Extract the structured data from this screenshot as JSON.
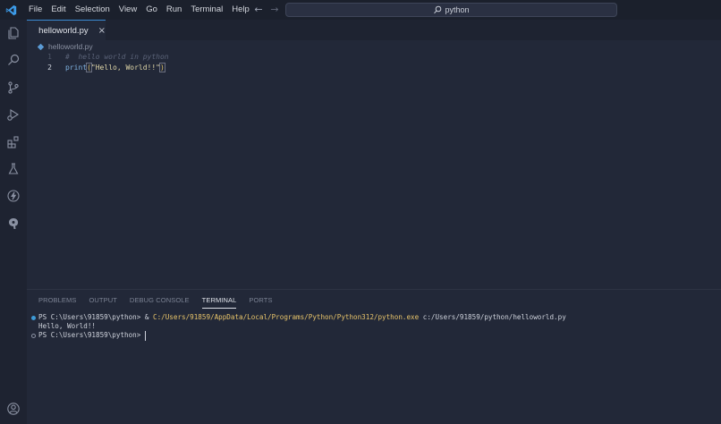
{
  "menu": {
    "items": [
      "File",
      "Edit",
      "Selection",
      "View",
      "Go",
      "Run",
      "Terminal",
      "Help"
    ]
  },
  "search": {
    "text": "python"
  },
  "tab": {
    "label": "helloworld.py",
    "close": "×"
  },
  "breadcrumb": {
    "file": "helloworld.py"
  },
  "editor": {
    "lines": [
      {
        "number": "1",
        "comment": "#  hello world in python"
      },
      {
        "number": "2",
        "fn": "print",
        "open": "(",
        "string": "\"Hello, World!!\"",
        "close": ")"
      }
    ]
  },
  "panel": {
    "tabs": [
      "PROBLEMS",
      "OUTPUT",
      "DEBUG CONSOLE",
      "TERMINAL",
      "PORTS"
    ],
    "active_tab": "TERMINAL"
  },
  "terminal": {
    "line1_prompt": "PS C:\\Users\\91859\\python> & ",
    "line1_exe": "C:/Users/91859/AppData/Local/Programs/Python/Python312/python.exe",
    "line1_arg": " c:/Users/91859/python/helloworld.py",
    "line2": "Hello, World!!",
    "line3": "PS C:\\Users\\91859\\python> "
  },
  "colors": {
    "accent": "#3a8bd4",
    "background": "#222838",
    "titlebar": "#1b202c",
    "exe_path": "#e8c46a"
  }
}
